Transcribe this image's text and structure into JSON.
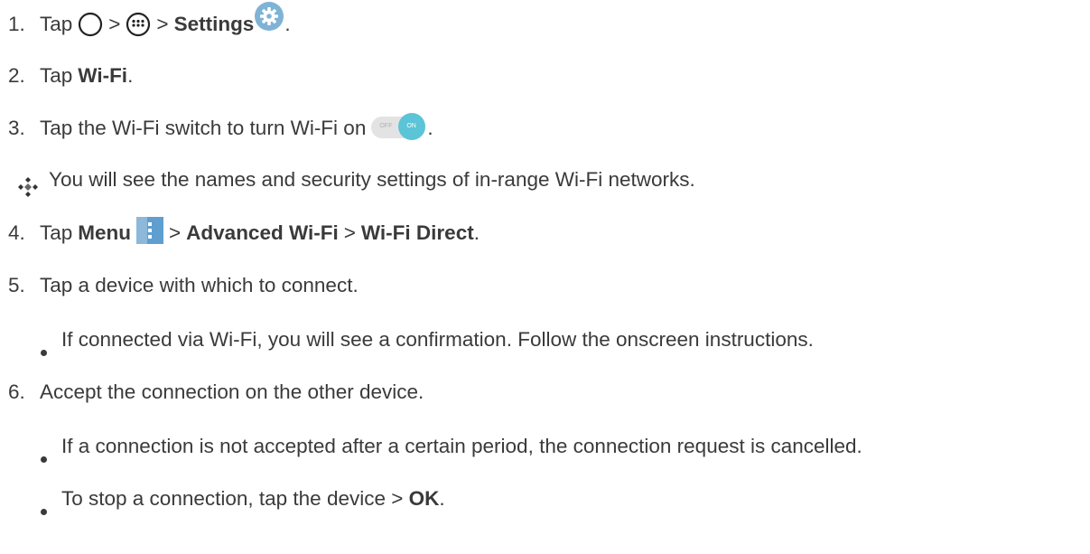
{
  "steps": [
    {
      "num": "1.",
      "tap": "Tap",
      "gt": ">",
      "settings": "Settings",
      "period": "."
    },
    {
      "num": "2.",
      "tap": "Tap",
      "wifi": "Wi-Fi",
      "period": "."
    },
    {
      "num": "3.",
      "text": "Tap the Wi-Fi switch to turn Wi-Fi on",
      "switch_off": "OFF",
      "switch_on": "ON",
      "period": "."
    },
    {
      "num": "4.",
      "tap": "Tap",
      "menu": "Menu",
      "gt": ">",
      "advanced": "Advanced Wi-Fi",
      "direct": "Wi-Fi Direct",
      "period": "."
    },
    {
      "num": "5.",
      "text": "Tap a device with which to connect."
    },
    {
      "num": "6.",
      "text": "Accept the connection on the other device."
    }
  ],
  "note": "You will see the names and security settings of in-range Wi-Fi networks.",
  "bullets": {
    "step5": "If connected via Wi-Fi, you will see a confirmation. Follow the onscreen instructions.",
    "step6_a": "If a connection is not accepted after a certain period, the connection request is cancelled.",
    "step6_b_prefix": "To stop a connection, tap the device >",
    "step6_b_ok": "OK",
    "step6_b_period": "."
  },
  "icons": {
    "home": "home-circle-icon",
    "apps": "apps-grid-icon",
    "settings": "settings-gear-icon",
    "switch": "wifi-toggle-switch-icon",
    "menu": "menu-dots-icon",
    "note": "diamond-note-icon"
  },
  "colors": {
    "text": "#3a3a3a",
    "settings_icon": "#7fb3d5",
    "switch_on": "#5bc4d6",
    "menu_icon": "#5e9fd0"
  }
}
